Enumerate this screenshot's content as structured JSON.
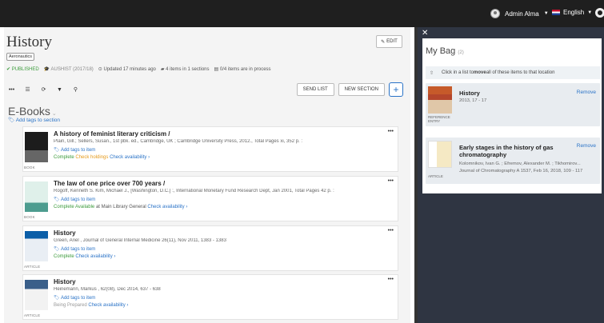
{
  "header": {
    "user": "Admin Alma",
    "language": "English"
  },
  "page": {
    "title": "History",
    "tag": "Aeronautics",
    "edit_label": "EDIT",
    "status": {
      "published": "PUBLISHED",
      "course": "AUSHIST (2017/18)",
      "updated": "Updated 17 minutes ago",
      "items": "4 items in 1 sections",
      "process": "0/4 items are in process"
    },
    "toolbar": {
      "send_list": "SEND LIST",
      "new_section": "NEW SECTION"
    }
  },
  "section": {
    "title": "E-Books",
    "tags_link": "Add tags to section"
  },
  "items": [
    {
      "title": "A history of feminist literary criticism /",
      "meta": "Plain, Gill.; Sellers, Susan., 1st pbk. ed., Cambridge, UK ; Cambridge University Press, 2012., Total Pages xi, 352 p. :",
      "tags": "Add tags to item",
      "kind": "BOOK",
      "s1": "Complete",
      "s2": "Check holdings",
      "s3": "Check availability ›"
    },
    {
      "title": "The law of one price over 700 years /",
      "meta": "Rogoff, Kenneth S. Kim, Michael J., [Washington, D.C.] :, International Monetary Fund Research Dept, Jan 2001, Total Pages 42 p. :",
      "tags": "Add tags to item",
      "kind": "BOOK",
      "s1": "Complete",
      "s2": "Available",
      "s2b": "at Main Library General",
      "s3": "Check availability ›"
    },
    {
      "title": "History",
      "meta": "Green, Ariel , Journal of General Internal Medicine 26(11), Nov 2011, 1383 - 1383",
      "tags": "Add tags to item",
      "kind": "ARTICLE",
      "s1": "Complete",
      "s3": "Check availability ›"
    },
    {
      "title": "History",
      "meta": "Heinemann, Markus , 62(08), Dec 2014, 637 - 638",
      "tags": "Add tags to item",
      "kind": "ARTICLE",
      "s1": "Being Prepared",
      "s3": "Check availability ›"
    }
  ],
  "bag": {
    "title": "My Bag",
    "count": "(2)",
    "hint_pre": "Click in a list to ",
    "hint_bold": "move",
    "hint_post": " all of these items to that location",
    "items": [
      {
        "title": "History",
        "meta": "2013, 17 - 17",
        "kind": "REFERENCE ENTRY",
        "remove": "Remove"
      },
      {
        "title": "Early stages in the history of gas chromatography",
        "meta": "Kolomnikov, Ivan G. ; Efremov, Alexander M. ; Tikhomirov...",
        "meta2": "Journal of Chromatography A 1537, Feb 16, 2018, 109 - 117",
        "kind": "ARTICLE",
        "remove": "Remove"
      }
    ]
  }
}
